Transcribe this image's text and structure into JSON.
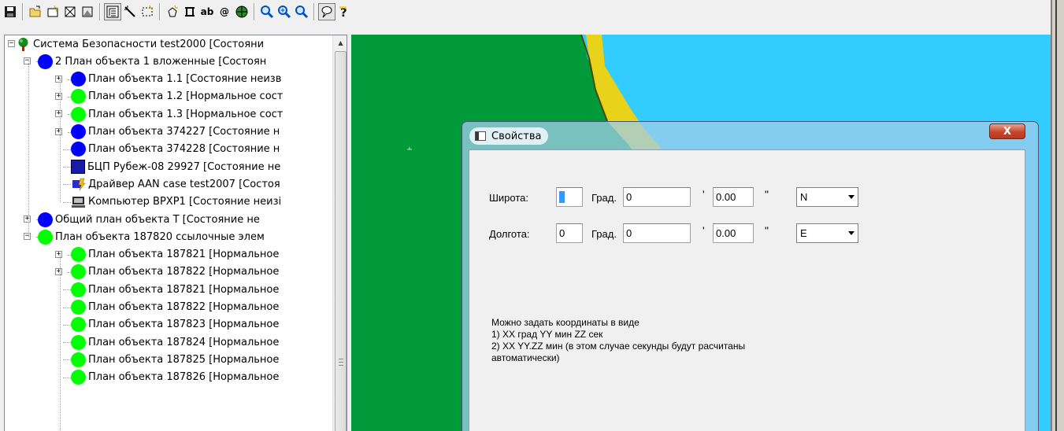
{
  "toolbar": {
    "buttons": [
      "save-icon",
      "open-icon",
      "new-icon",
      "delete-icon",
      "image-icon",
      "tree-icon",
      "wand-icon",
      "select-area-icon",
      "polygon-icon",
      "frame-icon",
      "text-icon",
      "at-icon",
      "globe-icon",
      "zoom-out-icon",
      "zoom-in-icon",
      "zoom-fit-icon",
      "balloon-icon",
      "help-icon"
    ],
    "text_button_label": "ab",
    "at_button_label": "@"
  },
  "tree": {
    "items": [
      {
        "label": "Система Безопасности test2000 [Состояни",
        "icon": "tree-root-icon",
        "level": 0,
        "expander": "−"
      },
      {
        "label": "2 План объекта 1 вложенные [Состоян",
        "icon": "blue",
        "level": 1,
        "expander": "−"
      },
      {
        "label": "План объекта 1.1 [Состояние неизв",
        "icon": "blue",
        "level": 2,
        "expander": "+"
      },
      {
        "label": "План объекта 1.2 [Нормальное сост",
        "icon": "green",
        "level": 2,
        "expander": "+"
      },
      {
        "label": "План объекта 1.3 [Нормальное сост",
        "icon": "green",
        "level": 2,
        "expander": "+"
      },
      {
        "label": "План объекта 374227 [Состояние н",
        "icon": "blue",
        "level": 2,
        "expander": "+"
      },
      {
        "label": "План объекта 374228 [Состояние н",
        "icon": "blue",
        "level": 2,
        "expander": ""
      },
      {
        "label": "БЦП Рубеж-08 29927 [Состояние не",
        "icon": "square",
        "level": 2,
        "expander": ""
      },
      {
        "label": "Драйвер AAN case test2007 [Состоя",
        "icon": "driver",
        "level": 2,
        "expander": ""
      },
      {
        "label": "Компьютер BPXP1 [Состояние неизі",
        "icon": "computer",
        "level": 2,
        "expander": ""
      },
      {
        "label": "Общий план объекта Т [Состояние не",
        "icon": "blue",
        "level": 1,
        "expander": "+"
      },
      {
        "label": "План объекта 187820 ссылочные элем",
        "icon": "green",
        "level": 1,
        "expander": "−"
      },
      {
        "label": "План объекта 187821 [Нормальное",
        "icon": "green",
        "level": 2,
        "expander": "+"
      },
      {
        "label": "План объекта 187822 [Нормальное",
        "icon": "green",
        "level": 2,
        "expander": "+"
      },
      {
        "label": "План объекта 187821 [Нормальное",
        "icon": "green",
        "level": 2,
        "expander": ""
      },
      {
        "label": "План объекта 187822 [Нормальное",
        "icon": "green",
        "level": 2,
        "expander": ""
      },
      {
        "label": "План объекта 187823 [Нормальное",
        "icon": "green",
        "level": 2,
        "expander": ""
      },
      {
        "label": "План объекта 187824 [Нормальное",
        "icon": "green",
        "level": 2,
        "expander": ""
      },
      {
        "label": "План объекта 187825 [Нормальное",
        "icon": "green",
        "level": 2,
        "expander": ""
      },
      {
        "label": "План объекта 187826 [Нормальное",
        "icon": "green",
        "level": 2,
        "expander": ""
      }
    ]
  },
  "map": {
    "colors": {
      "land": "#009a3a",
      "water": "#33ccff",
      "sand": "#e8d21a"
    }
  },
  "dialog": {
    "title": "Свойства",
    "close_label": "X",
    "latitude": {
      "label": "Широта:",
      "deg": "0",
      "deg_unit": "Град.",
      "min": "0",
      "min_unit": "'",
      "sec": "0.00",
      "sec_unit": "\"",
      "hemisphere": "N"
    },
    "longitude": {
      "label": "Долгота:",
      "deg": "0",
      "deg_unit": "Град.",
      "min": "0",
      "min_unit": "'",
      "sec": "0.00",
      "sec_unit": "\"",
      "hemisphere": "E"
    },
    "hint": [
      "Можно задать координаты в виде",
      "1) XX град YY мин ZZ сек",
      "2) XX YY.ZZ мин (в этом случае секунды будут расчитаны",
      "автоматически)"
    ]
  }
}
